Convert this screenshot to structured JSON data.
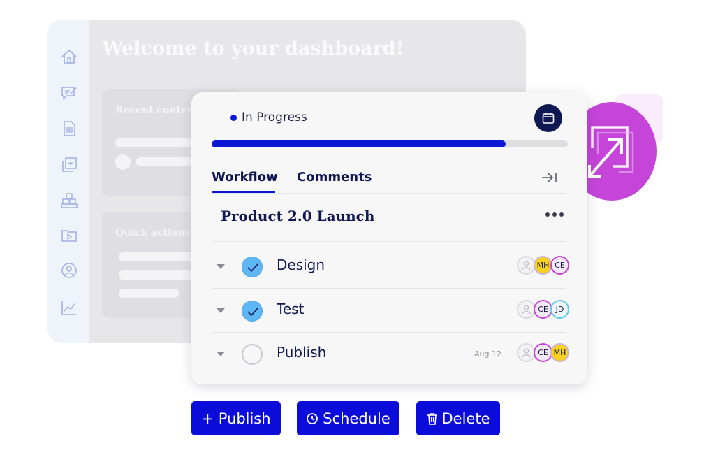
{
  "dashboard": {
    "title": "Welcome to your dashboard!",
    "cards": [
      {
        "title": "Recent content"
      },
      {
        "title": "Quick actions"
      }
    ],
    "sidebar_icons": [
      "home-icon",
      "edit-note-icon",
      "document-icon",
      "add-copy-icon",
      "blocks-icon",
      "video-folder-icon",
      "user-circle-icon",
      "chart-icon"
    ]
  },
  "expand_badge": {
    "icon": "expand-icon",
    "color": "#c545d9"
  },
  "card": {
    "status": "In Progress",
    "progress_fraction": 0.825,
    "tabs": [
      {
        "label": "Workflow",
        "active": true
      },
      {
        "label": "Comments",
        "active": false
      }
    ],
    "project_title": "Product 2.0 Launch",
    "tasks": [
      {
        "label": "Design",
        "done": true,
        "date": "",
        "assignees": [
          "MH",
          "CE"
        ]
      },
      {
        "label": "Test",
        "done": true,
        "date": "",
        "assignees": [
          "CE",
          "JD"
        ]
      },
      {
        "label": "Publish",
        "done": false,
        "date": "Aug 12",
        "assignees": [
          "CE",
          "MH"
        ]
      }
    ]
  },
  "actions": {
    "publish": "+ Publish",
    "schedule": "Schedule",
    "delete": "Delete"
  },
  "colors": {
    "accent": "#0b18d6",
    "navy": "#0f1850",
    "check": "#5fb6f4"
  }
}
